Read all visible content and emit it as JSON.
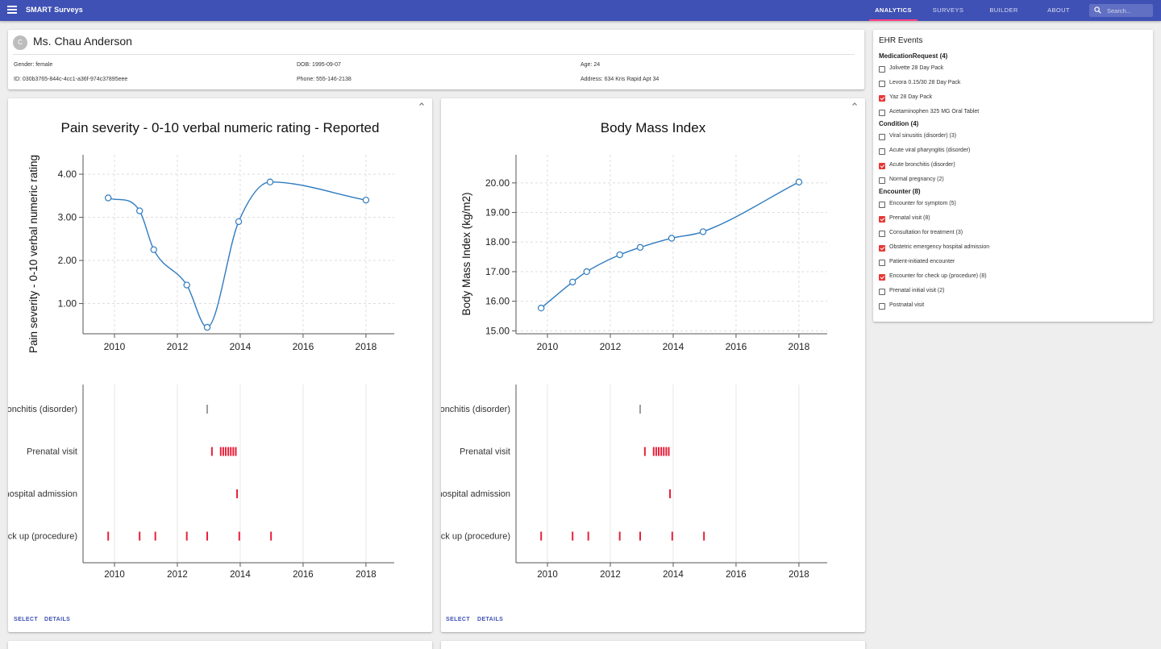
{
  "app": {
    "title": "SMART Surveys",
    "menu_icon": "menu-icon"
  },
  "nav": {
    "tabs": [
      "ANALYTICS",
      "SURVEYS",
      "BUILDER",
      "ABOUT"
    ],
    "active": "ANALYTICS",
    "search_placeholder": "Search..."
  },
  "patient": {
    "avatar_initial": "C",
    "name": "Ms. Chau Anderson",
    "gender": "Gender: female",
    "dob": "DOB: 1995-09-07",
    "age": "Age: 24",
    "id": "ID: 030b3765-844c-4cc1-a36f-974c37895eee",
    "phone": "Phone: 555-146-2138",
    "address": "Address: 634 Kris Rapid Apt 34"
  },
  "colors": {
    "primary": "#3f51b5",
    "accent": "#ff4081",
    "line": "#2f7bbf",
    "event_red": "#e8203a",
    "event_gray": "#9e9e9e",
    "checkbox_checked": "#e53935"
  },
  "card_actions": {
    "select": "SELECT",
    "details": "DETAILS",
    "collapse_icon": "chevron-up-icon"
  },
  "chart_data": [
    {
      "type": "line",
      "title": "Pain severity - 0-10 verbal numeric rating - Reported",
      "xlabel": "",
      "ylabel": "Pain severity - 0-10 verbal numeric rating",
      "xlim": [
        2009,
        2018.9
      ],
      "ylim": [
        0.3,
        4.45
      ],
      "xticks": [
        "2010",
        "2012",
        "2014",
        "2016",
        "2018"
      ],
      "yticks": [
        "1.00",
        "2.00",
        "3.00",
        "4.00"
      ],
      "grid": true,
      "x": [
        2009.8,
        2010.8,
        2011.25,
        2012.3,
        2012.95,
        2013.95,
        2014.95,
        2018.0
      ],
      "y": [
        3.45,
        3.15,
        2.25,
        1.43,
        0.45,
        2.9,
        3.82,
        3.4
      ]
    },
    {
      "type": "line",
      "title": "Body Mass Index",
      "xlabel": "",
      "ylabel": "Body Mass Index (kg/m2)",
      "xlim": [
        2009,
        2018.9
      ],
      "ylim": [
        14.9,
        20.95
      ],
      "xticks": [
        "2010",
        "2012",
        "2014",
        "2016",
        "2018"
      ],
      "yticks": [
        "15.00",
        "16.00",
        "17.00",
        "18.00",
        "19.00",
        "20.00"
      ],
      "grid": true,
      "x": [
        2009.8,
        2010.8,
        2011.25,
        2012.3,
        2012.95,
        2013.95,
        2014.95,
        2018.0
      ],
      "y": [
        15.77,
        16.65,
        17.0,
        17.57,
        17.82,
        18.13,
        18.35,
        20.03
      ]
    }
  ],
  "timeline": {
    "xlim": [
      2009,
      2018.9
    ],
    "xticks": [
      "2010",
      "2012",
      "2014",
      "2016",
      "2018"
    ],
    "rows": [
      {
        "label": "Acute bronchitis (disorder)",
        "color": "gray",
        "dates": [
          2012.95
        ]
      },
      {
        "label": "Prenatal visit",
        "color": "red",
        "dates": [
          2013.1,
          2013.38,
          2013.46,
          2013.54,
          2013.62,
          2013.7,
          2013.78,
          2013.86
        ]
      },
      {
        "label": "Obstetric emergency hospital admission",
        "color": "red",
        "dates": [
          2013.9
        ]
      },
      {
        "label": "Encounter for check up (procedure)",
        "color": "red",
        "dates": [
          2009.8,
          2010.8,
          2011.3,
          2012.3,
          2012.95,
          2013.97,
          2014.98
        ]
      }
    ]
  },
  "ehr": {
    "title": "EHR Events",
    "groups": [
      {
        "name": "MedicationRequest (4)",
        "items": [
          {
            "label": "Jolivette 28 Day Pack",
            "checked": false
          },
          {
            "label": "Levora 0.15/30 28 Day Pack",
            "checked": false
          },
          {
            "label": "Yaz 28 Day Pack",
            "checked": true
          },
          {
            "label": "Acetaminophen 325 MG Oral Tablet",
            "checked": false
          }
        ]
      },
      {
        "name": "Condition (4)",
        "items": [
          {
            "label": "Viral sinusitis (disorder) (3)",
            "checked": false
          },
          {
            "label": "Acute viral pharyngitis (disorder)",
            "checked": false
          },
          {
            "label": "Acute bronchitis (disorder)",
            "checked": true
          },
          {
            "label": "Normal pregnancy (2)",
            "checked": false
          }
        ]
      },
      {
        "name": "Encounter (8)",
        "items": [
          {
            "label": "Encounter for symptom (5)",
            "checked": false
          },
          {
            "label": "Prenatal visit (8)",
            "checked": true
          },
          {
            "label": "Consultation for treatment (3)",
            "checked": false
          },
          {
            "label": "Obstetric emergency hospital admission",
            "checked": true
          },
          {
            "label": "Patient-initiated encounter",
            "checked": false
          },
          {
            "label": "Encounter for check up (procedure) (8)",
            "checked": true
          },
          {
            "label": "Prenatal initial visit (2)",
            "checked": false
          },
          {
            "label": "Postnatal visit",
            "checked": false
          }
        ]
      }
    ]
  }
}
